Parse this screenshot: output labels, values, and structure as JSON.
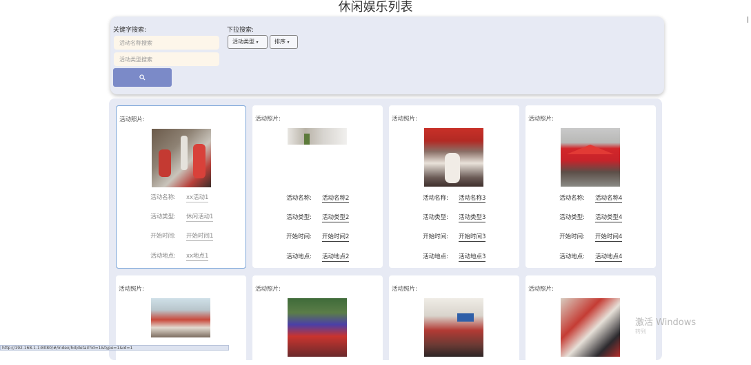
{
  "page_title": "休闲娱乐列表",
  "search": {
    "keyword_label": "关键字搜索:",
    "name_placeholder": "活动名称搜索",
    "type_placeholder": "活动类型搜索",
    "button_icon": "search-icon",
    "dropdown_label": "下拉搜索:",
    "type_dropdown": "活动类型",
    "sort_dropdown": "排序"
  },
  "list": {
    "cards": [
      {
        "photo_label": "活动照片:",
        "name_key": "活动名称:",
        "name": "xx活动1",
        "type_key": "活动类型:",
        "type": "休闲活动1",
        "time_key": "开始时间:",
        "time": "开始时间1",
        "place_key": "活动地点:",
        "place": "xx地点1"
      },
      {
        "photo_label": "活动照片:",
        "name_key": "活动名称:",
        "name": "活动名称2",
        "type_key": "活动类型:",
        "type": "活动类型2",
        "time_key": "开始时间:",
        "time": "开始时间2",
        "place_key": "活动地点:",
        "place": "活动地点2"
      },
      {
        "photo_label": "活动照片:",
        "name_key": "活动名称:",
        "name": "活动名称3",
        "type_key": "活动类型:",
        "type": "活动类型3",
        "time_key": "开始时间:",
        "time": "开始时间3",
        "place_key": "活动地点:",
        "place": "活动地点3"
      },
      {
        "photo_label": "活动照片:",
        "name_key": "活动名称:",
        "name": "活动名称4",
        "type_key": "活动类型:",
        "type": "活动类型4",
        "time_key": "开始时间:",
        "time": "开始时间4",
        "place_key": "活动地点:",
        "place": "活动地点4"
      },
      {
        "photo_label": "活动照片:"
      },
      {
        "photo_label": "活动照片:"
      },
      {
        "photo_label": "活动照片:"
      },
      {
        "photo_label": "活动照片:"
      }
    ]
  },
  "watermark": {
    "line1": "激活 Windows",
    "line2": "转到"
  },
  "statusbar": "http://192.168.1.1:8080/#/index/hd/detail?id=1&type=1&id=1",
  "colors": {
    "accent": "#7b8ac8",
    "panel": "#e7eaf4",
    "input_bg": "#fdf6ea"
  }
}
